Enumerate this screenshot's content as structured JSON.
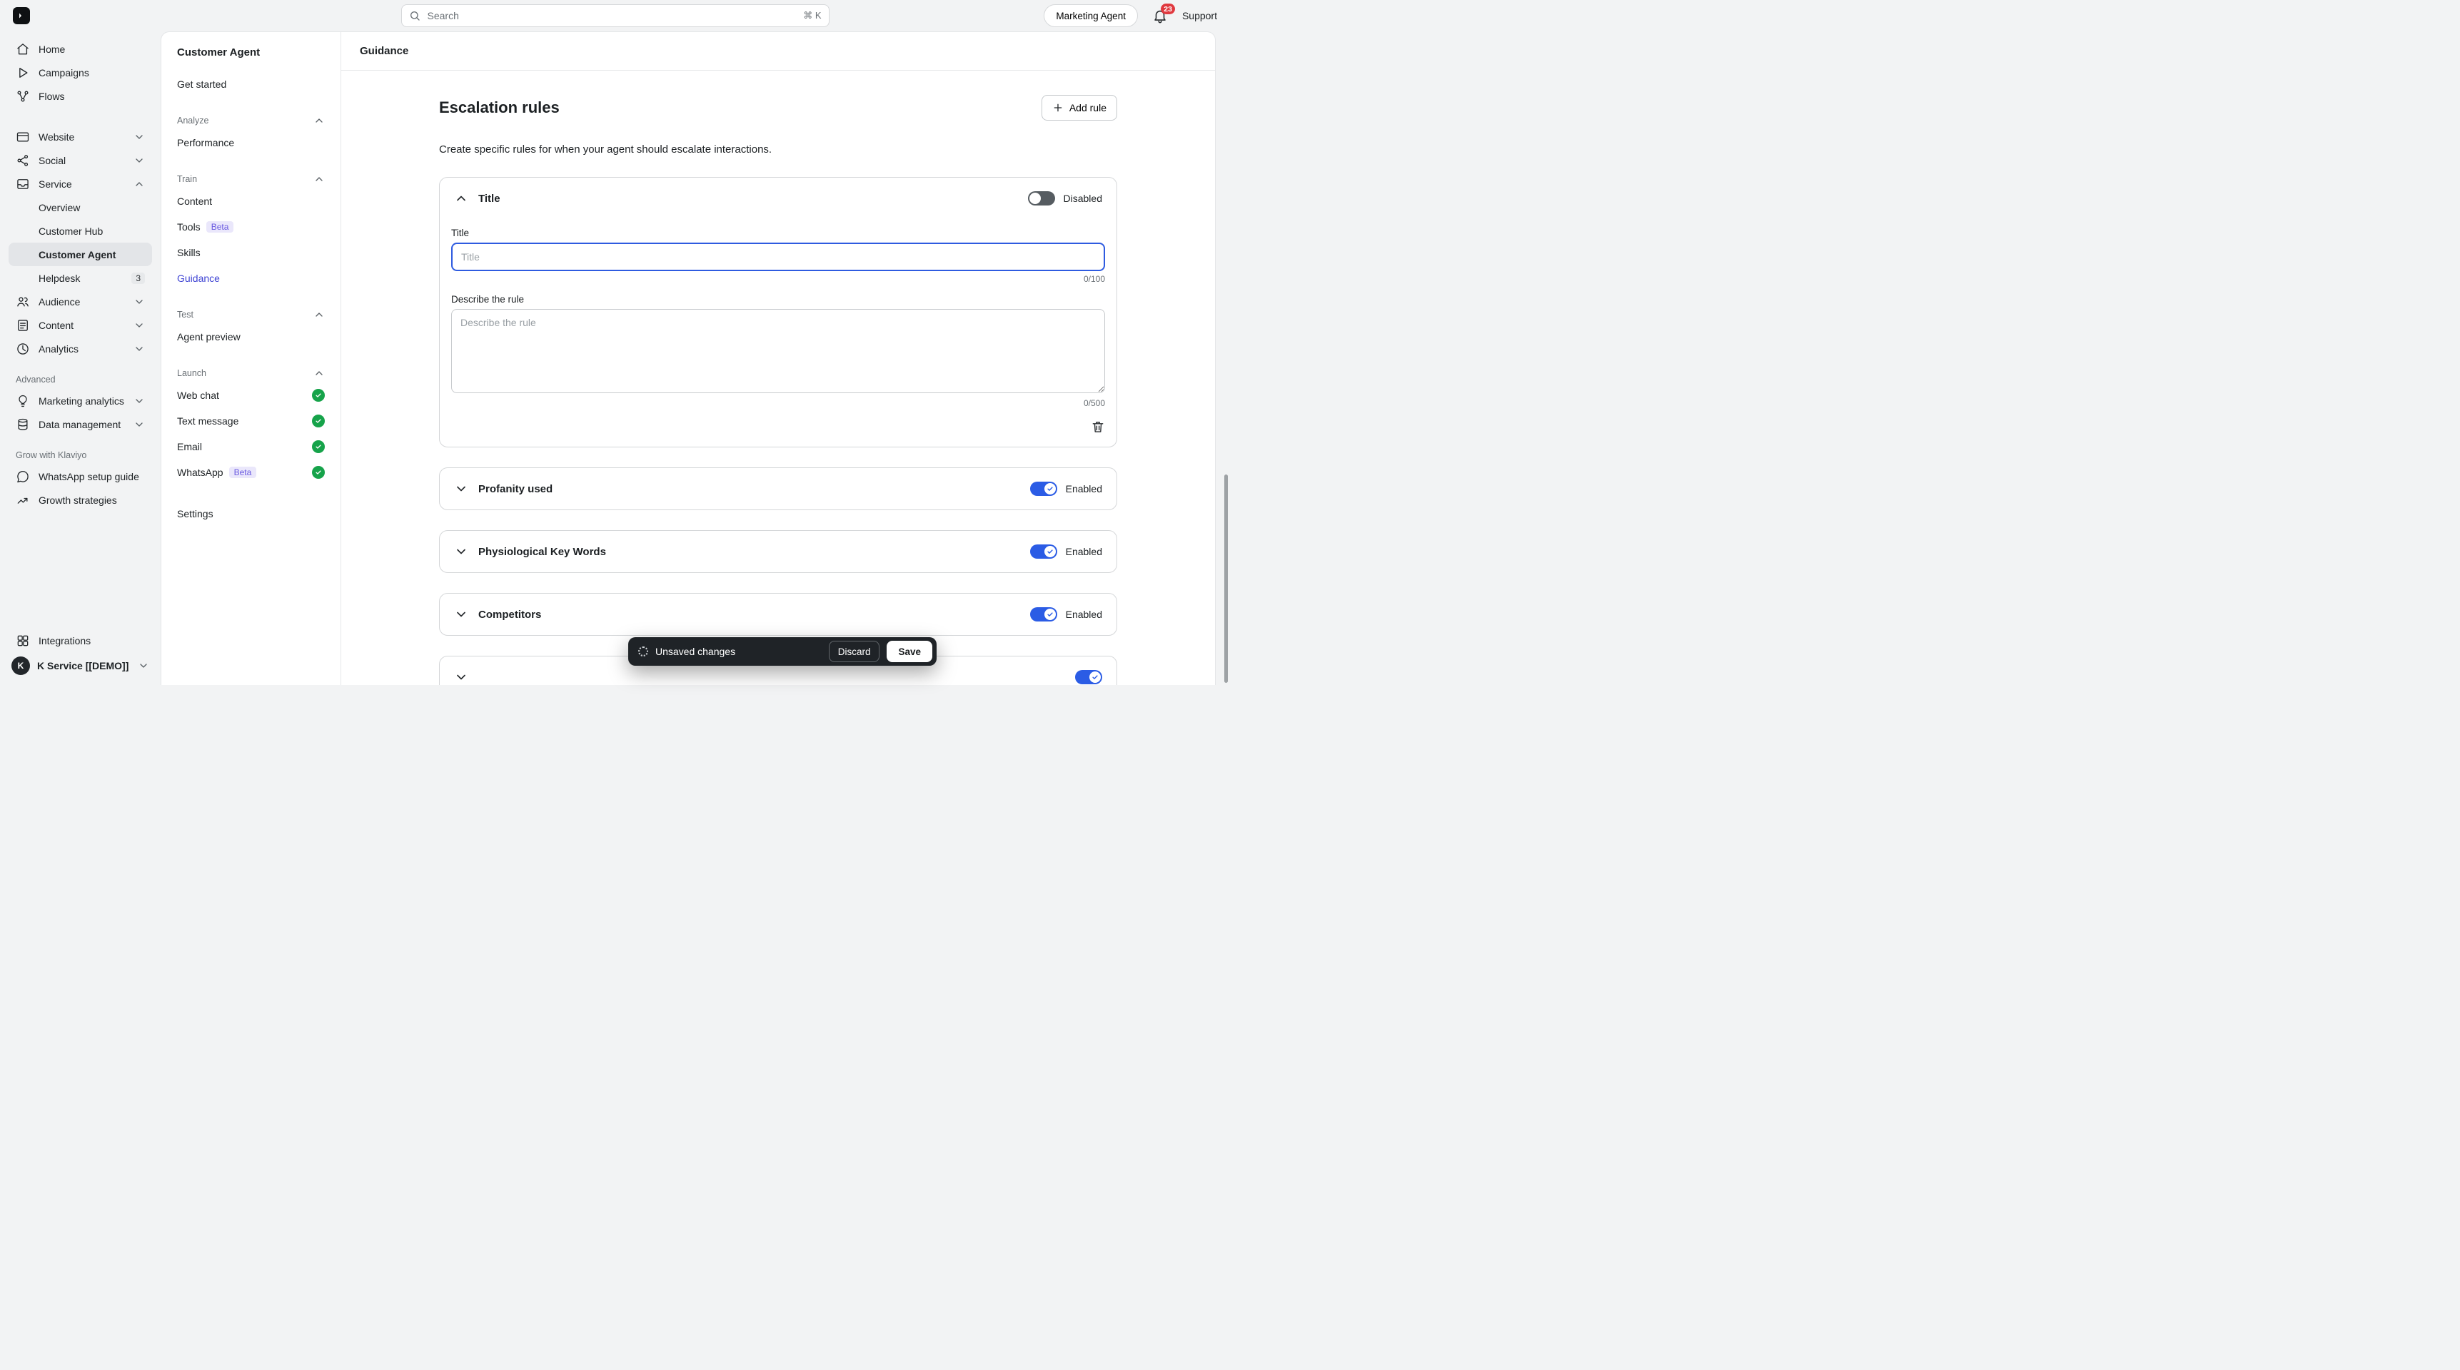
{
  "colors": {
    "accent": "#3f44d4",
    "toggle_on": "#2b5ce5",
    "success": "#16a34a",
    "alert": "#e0393f"
  },
  "topbar": {
    "search_placeholder": "Search",
    "search_shortcut": "⌘ K",
    "marketing_agent": "Marketing Agent",
    "notification_count": "23",
    "support": "Support"
  },
  "sidebar": {
    "home": "Home",
    "campaigns": "Campaigns",
    "flows": "Flows",
    "website": "Website",
    "social": "Social",
    "service": "Service",
    "overview": "Overview",
    "customer_hub": "Customer Hub",
    "customer_agent": "Customer Agent",
    "helpdesk": "Helpdesk",
    "helpdesk_badge": "3",
    "audience": "Audience",
    "content": "Content",
    "analytics": "Analytics",
    "advanced": "Advanced",
    "marketing_analytics": "Marketing analytics",
    "data_management": "Data management",
    "grow": "Grow with Klaviyo",
    "whatsapp_setup": "WhatsApp setup guide",
    "growth_strategies": "Growth strategies",
    "integrations": "Integrations",
    "account": "K Service [[DEMO]]"
  },
  "subsidebar": {
    "title": "Customer Agent",
    "get_started": "Get started",
    "analyze": "Analyze",
    "performance": "Performance",
    "train": "Train",
    "content": "Content",
    "tools": "Tools",
    "beta": "Beta",
    "skills": "Skills",
    "guidance": "Guidance",
    "test": "Test",
    "agent_preview": "Agent preview",
    "launch": "Launch",
    "web_chat": "Web chat",
    "text_message": "Text message",
    "email": "Email",
    "whatsapp": "WhatsApp",
    "settings": "Settings"
  },
  "main": {
    "header": "Guidance",
    "title": "Escalation rules",
    "add_rule": "Add rule",
    "description": "Create specific rules for when your agent should escalate interactions.",
    "rules": [
      {
        "title": "Title",
        "state": "Disabled",
        "enabled": false
      },
      {
        "title": "Profanity used",
        "state": "Enabled",
        "enabled": true
      },
      {
        "title": "Physiological Key Words",
        "state": "Enabled",
        "enabled": true
      },
      {
        "title": "Competitors",
        "state": "Enabled",
        "enabled": true
      }
    ],
    "form": {
      "title_label": "Title",
      "title_placeholder": "Title",
      "title_counter": "0/100",
      "describe_label": "Describe the rule",
      "describe_placeholder": "Describe the rule",
      "describe_counter": "0/500"
    }
  },
  "toast": {
    "message": "Unsaved changes",
    "discard": "Discard",
    "save": "Save"
  }
}
